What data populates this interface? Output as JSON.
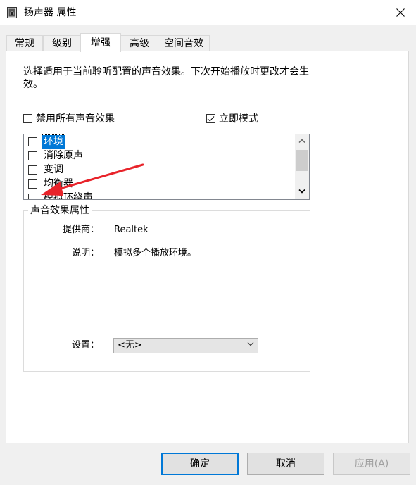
{
  "window": {
    "title": "扬声器 属性",
    "close_glyph": "✕"
  },
  "tabs": [
    {
      "label": "常规"
    },
    {
      "label": "级别"
    },
    {
      "label": "增强"
    },
    {
      "label": "高级"
    },
    {
      "label": "空间音效"
    }
  ],
  "active_tab": "增强",
  "description": "选择适用于当前聆听配置的声音效果。下次开始播放时更改才会生效。",
  "disable_all": {
    "label": "禁用所有声音效果",
    "checked": false
  },
  "immediate_mode": {
    "label": "立即模式",
    "checked": true
  },
  "effects_list": {
    "items": [
      {
        "label": "环境",
        "checked": false,
        "selected": true
      },
      {
        "label": "消除原声",
        "checked": false,
        "selected": false
      },
      {
        "label": "变调",
        "checked": false,
        "selected": false
      },
      {
        "label": "均衡器",
        "checked": false,
        "selected": false
      },
      {
        "label": "模拟环绕声",
        "checked": false,
        "selected": false
      }
    ]
  },
  "properties": {
    "group_title": "声音效果属性",
    "provider_label": "提供商：",
    "provider_value": "Realtek",
    "description_label": "说明：",
    "description_value": "模拟多个播放环境。",
    "settings_label": "设置：",
    "settings_value": "<无>"
  },
  "buttons": {
    "ok": "确定",
    "cancel": "取消",
    "apply": "应用(A)"
  },
  "colors": {
    "accent": "#0078d7",
    "annotation_arrow": "#e8232a"
  }
}
